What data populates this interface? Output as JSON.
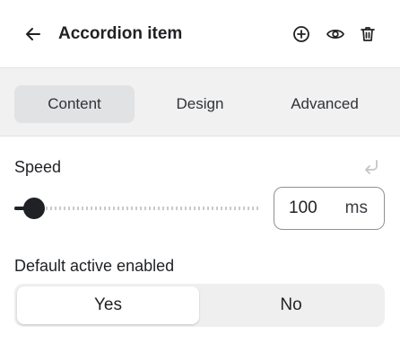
{
  "header": {
    "title": "Accordion item",
    "back_icon": "arrow-left-icon",
    "actions": [
      {
        "icon": "plus-circle-icon"
      },
      {
        "icon": "eye-icon"
      },
      {
        "icon": "trash-icon"
      }
    ]
  },
  "tabs": [
    {
      "label": "Content",
      "active": true
    },
    {
      "label": "Design",
      "active": false
    },
    {
      "label": "Advanced",
      "active": false
    }
  ],
  "speed": {
    "label": "Speed",
    "reset_icon": "undo-arrow-icon",
    "value": "100",
    "unit": "ms",
    "slider_fraction": 0.04
  },
  "default_active": {
    "label": "Default active enabled",
    "options": [
      "Yes",
      "No"
    ],
    "selected": "Yes"
  },
  "colors": {
    "text": "#1f2124",
    "tab_bg": "#f1f1f2",
    "active_tab": "#e1e2e4",
    "slider": "#1f2124"
  }
}
